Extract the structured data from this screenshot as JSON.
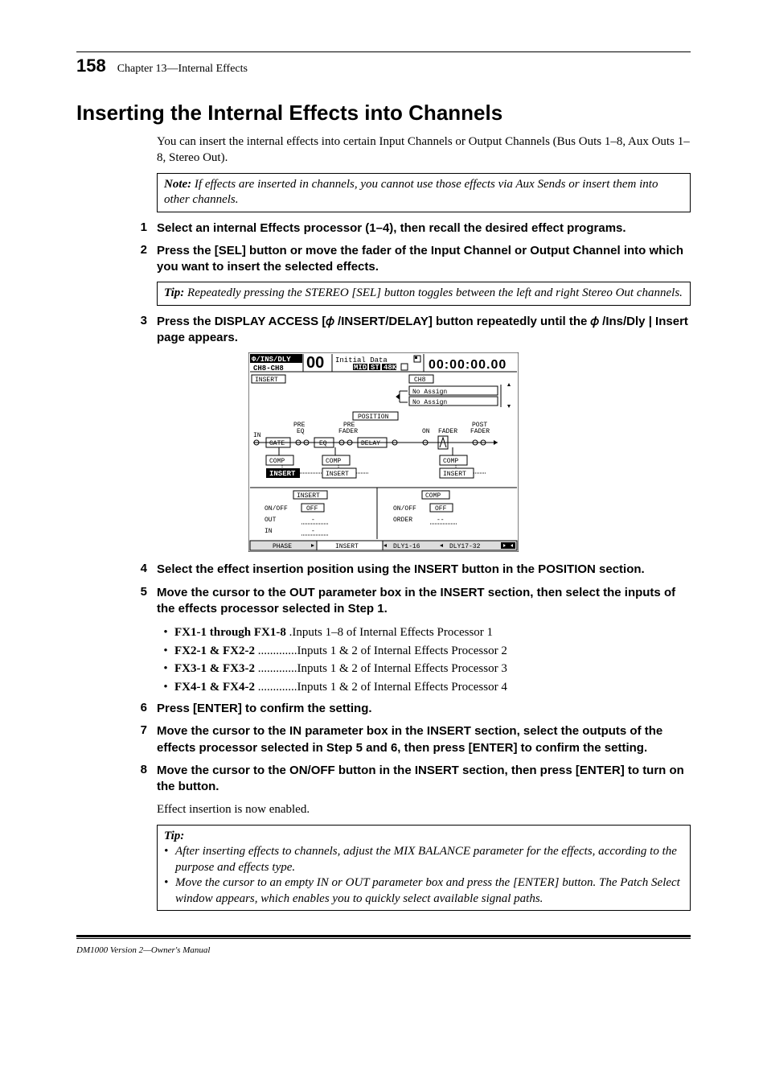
{
  "header": {
    "page_number": "158",
    "chapter": "Chapter 13—Internal Effects"
  },
  "heading": "Inserting the Internal Effects into Channels",
  "intro": "You can insert the internal effects into certain Input Channels or Output Channels (Bus Outs 1–8, Aux Outs 1–8, Stereo Out).",
  "note": {
    "label": "Note:",
    "text": " If effects are inserted in channels, you cannot use those effects via Aux Sends or insert them into other channels."
  },
  "steps": {
    "s1": {
      "n": "1",
      "t": "Select an internal Effects processor (1–4), then recall the desired effect programs."
    },
    "s2": {
      "n": "2",
      "t": "Press the [SEL] button or move the fader of the Input Channel or Output Channel into which you want to insert the selected effects."
    },
    "tip1": {
      "label": "Tip:",
      "text": " Repeatedly pressing the STEREO [SEL] button toggles between the left and right Stereo Out channels."
    },
    "s3": {
      "n": "3",
      "t_a": "Press the DISPLAY ACCESS [",
      "t_b": "/INSERT/DELAY] button repeatedly until the ",
      "t_c": "/Ins/Dly | Insert page appears."
    },
    "s4": {
      "n": "4",
      "t": "Select the effect insertion position using the INSERT button in the POSITION section."
    },
    "s5": {
      "n": "5",
      "t": "Move the cursor to the OUT parameter box in the INSERT section, then select the inputs of the effects processor selected in Step 1."
    },
    "fx": [
      {
        "label": "FX1-1 through FX1-8",
        "sep": " .",
        "desc": "Inputs 1–8 of Internal Effects Processor 1"
      },
      {
        "label": "FX2-1 & FX2-2",
        "sep": " .............",
        "desc": "Inputs 1 & 2 of Internal Effects Processor 2"
      },
      {
        "label": "FX3-1 & FX3-2",
        "sep": " .............",
        "desc": "Inputs 1 & 2 of Internal Effects Processor 3"
      },
      {
        "label": "FX4-1 & FX4-2",
        "sep": " .............",
        "desc": "Inputs 1 & 2 of Internal Effects Processor 4"
      }
    ],
    "s6": {
      "n": "6",
      "t": "Press [ENTER] to confirm the setting."
    },
    "s7": {
      "n": "7",
      "t": "Move the cursor to the IN parameter box in the INSERT section, select the outputs of the effects processor selected in Step 5 and 6, then press [ENTER] to confirm the setting."
    },
    "s8": {
      "n": "8",
      "t": "Move the cursor to the ON/OFF button in the INSERT section, then press [ENTER] to turn on the button."
    },
    "s8_body": "Effect insertion is now enabled."
  },
  "tip2": {
    "label": "Tip:",
    "items": [
      "After inserting effects to channels, adjust the MIX BALANCE parameter for the effects, according to the purpose and effects type.",
      "Move the cursor to an empty IN or OUT parameter box and press the [ENTER] button. The Patch Select window appears, which enables you to quickly select available signal paths."
    ]
  },
  "footer": "DM1000 Version 2—Owner's Manual",
  "figure": {
    "title_tab": "Φ/INS/DLY",
    "channel": "CH8-CH8",
    "prog_num": "00",
    "prog_name": "Initial Data",
    "indicators": [
      "MIDI",
      "ST",
      "48K"
    ],
    "timecode": "00:00:00.00",
    "section_insert": "INSERT",
    "ch_label": "CH8",
    "assign1": "No Assign",
    "assign2": "No Assign",
    "position": "POSITION",
    "labels": {
      "pre_eq": "PRE\nEQ",
      "pre_fader": "PRE\nFADER",
      "on": "ON",
      "fader": "FADER",
      "post_fader": "POST\nFADER",
      "in": "IN",
      "gate": "GATE",
      "eq": "EQ",
      "delay": "DELAY",
      "comp": "COMP",
      "insert": "INSERT"
    },
    "insert_sec": {
      "title": "INSERT",
      "onoff": "ON/OFF",
      "onoff_val": "OFF",
      "out": "OUT",
      "out_val": "-",
      "in": "IN",
      "in_val": "-"
    },
    "comp_sec": {
      "title": "COMP",
      "onoff": "ON/OFF",
      "onoff_val": "OFF",
      "order": "ORDER",
      "order_val": "--"
    },
    "tabs": [
      "PHASE",
      "INSERT",
      "DLY1-16",
      "DLY17-32"
    ]
  }
}
